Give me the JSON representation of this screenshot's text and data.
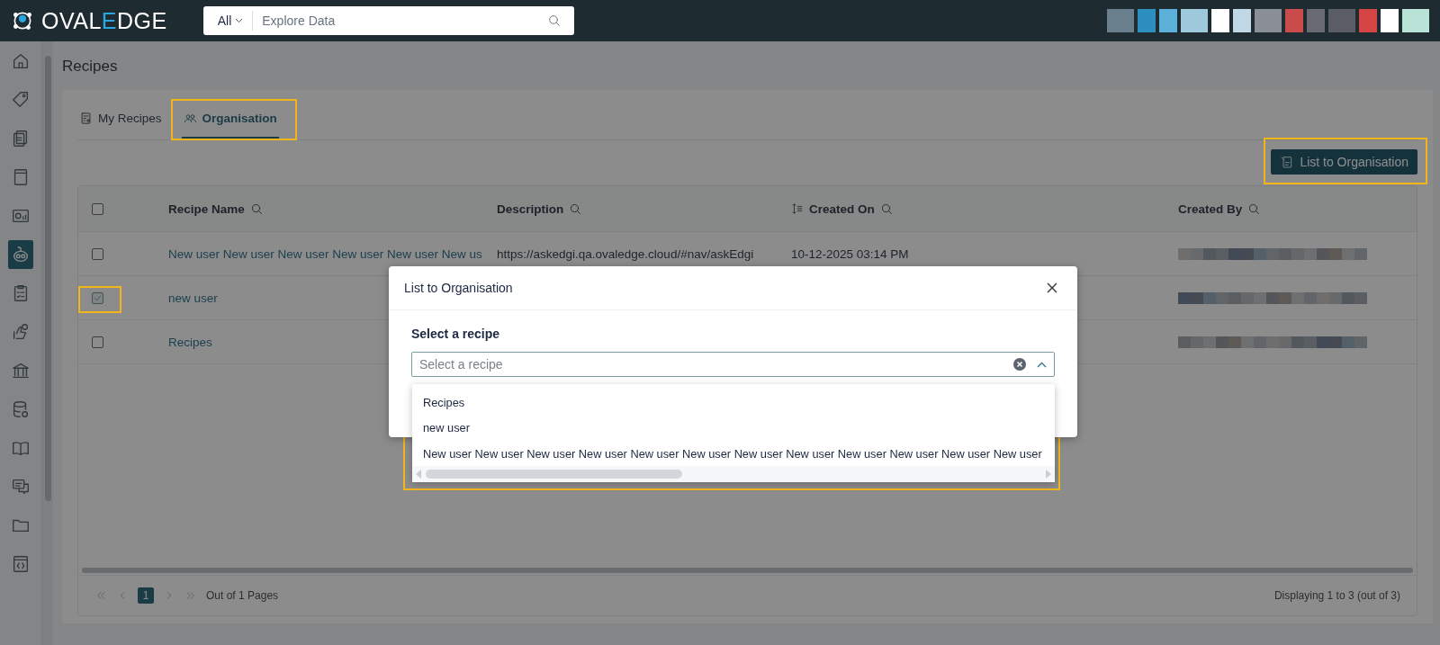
{
  "header": {
    "logo_parts": [
      {
        "text": "OVAL",
        "color": "#ffffff"
      },
      {
        "text": "E",
        "color": "#2aa6e0"
      },
      {
        "text": "DGE",
        "color": "#ffffff"
      }
    ],
    "search": {
      "scope": "All",
      "placeholder": "Explore Data"
    }
  },
  "sidebar": {
    "items": [
      {
        "kind": "home",
        "selected": false
      },
      {
        "kind": "tag",
        "selected": false
      },
      {
        "kind": "documents",
        "selected": false
      },
      {
        "kind": "book",
        "selected": false
      },
      {
        "kind": "chart",
        "selected": false
      },
      {
        "kind": "robot",
        "selected": true
      },
      {
        "kind": "checklist",
        "selected": false
      },
      {
        "kind": "hand",
        "selected": false
      },
      {
        "kind": "bank",
        "selected": false
      },
      {
        "kind": "database",
        "selected": false
      },
      {
        "kind": "open-book",
        "selected": false
      },
      {
        "kind": "chat",
        "selected": false
      },
      {
        "kind": "folder",
        "selected": false
      },
      {
        "kind": "code",
        "selected": false
      }
    ]
  },
  "page": {
    "title": "Recipes"
  },
  "highlight_frames": [
    {
      "kind": "tab"
    },
    {
      "kind": "toolbar-button"
    },
    {
      "kind": "row-checkbox"
    },
    {
      "kind": "dialog-field"
    }
  ],
  "tabs": [
    {
      "label": "My Recipes",
      "kind": "recipes",
      "selected": false
    },
    {
      "label": "Organisation",
      "kind": "people",
      "selected": true
    }
  ],
  "toolbar": {
    "button": "List to Organisation"
  },
  "table": {
    "header_checked": false,
    "columns": [
      {
        "label": "Recipe Name",
        "sortable": false
      },
      {
        "label": "Description",
        "sortable": false
      },
      {
        "label": "Created On",
        "sortable": true
      },
      {
        "label": "Created By",
        "sortable": false
      }
    ],
    "rows": [
      {
        "checked": false,
        "name": "New user New user New user New user New user New us",
        "description": "https://askedgi.qa.ovaledge.cloud/#nav/askEdgi",
        "created_on": "10-12-2025 03:14 PM"
      },
      {
        "checked": true,
        "name": "new user"
      },
      {
        "checked": false,
        "name": "Recipes"
      }
    ]
  },
  "pagination": {
    "current_page": "1",
    "pages_text": "Out of 1 Pages",
    "summary": "Displaying 1 to 3 (out of 3)"
  },
  "dialog": {
    "title": "List to Organisation",
    "field_label": "Select a recipe",
    "placeholder": "Select a recipe",
    "options": [
      "Recipes",
      "new user",
      "New user New user New user New user New user New user New user New user New user New user New user New user"
    ]
  }
}
